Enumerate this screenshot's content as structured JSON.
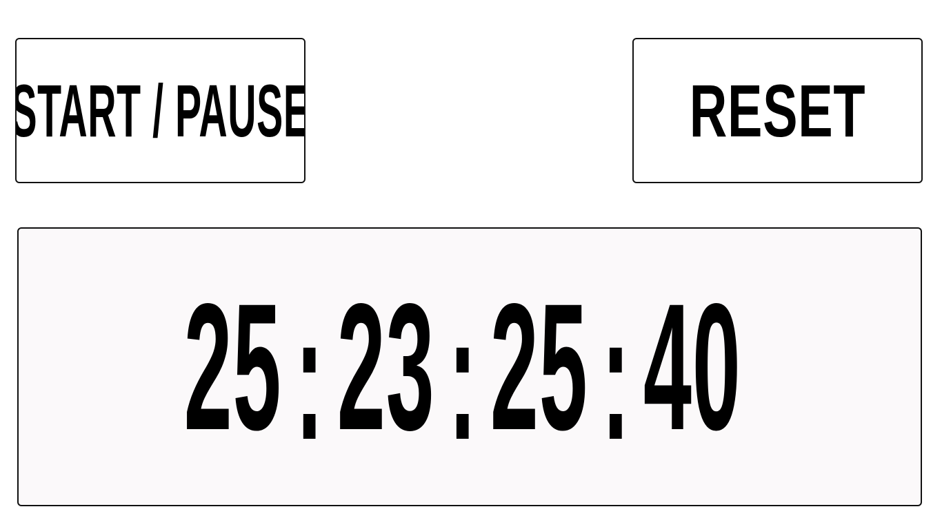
{
  "controls": {
    "start_pause_label": "START / PAUSE",
    "reset_label": "RESET"
  },
  "timer": {
    "hours": "25",
    "minutes": "23",
    "seconds": "25",
    "hundredths": "40",
    "separator": ":"
  },
  "colors": {
    "text": "#000000",
    "border": "#111111",
    "button_background": "#ffffff",
    "display_background": "#fbf9fa"
  }
}
